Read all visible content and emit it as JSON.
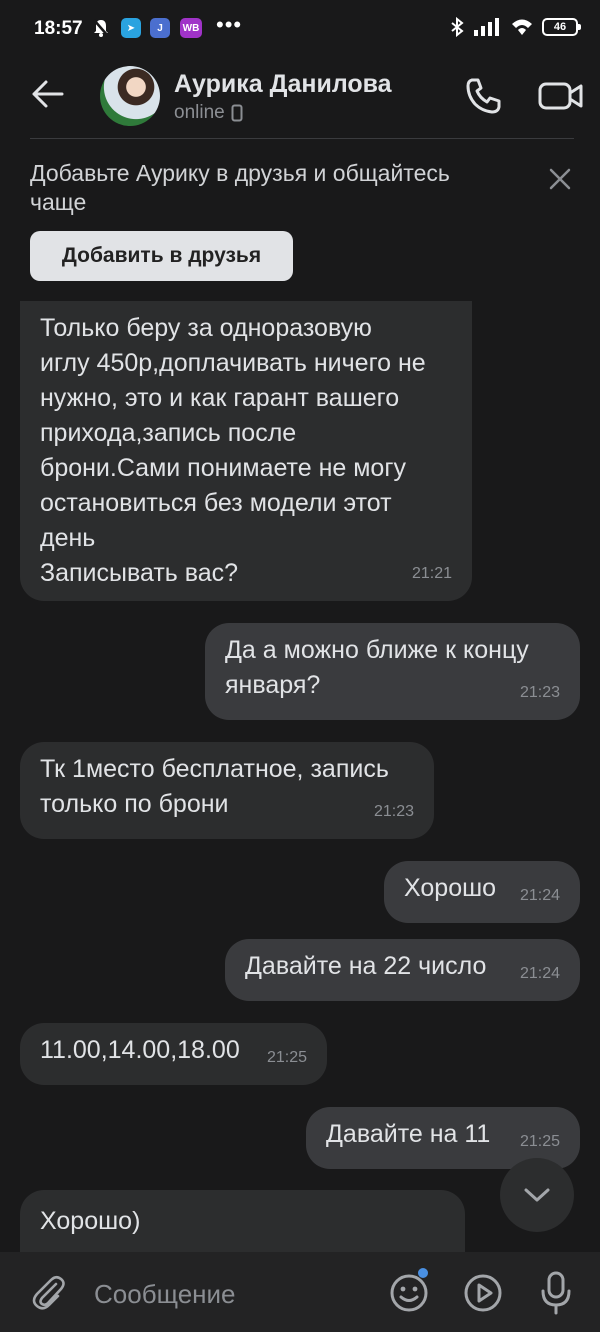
{
  "statusbar": {
    "time": "18:57",
    "app_badge": "WB",
    "dots": "•••",
    "battery": "46"
  },
  "header": {
    "name": "Аурика Данилова",
    "status": "online"
  },
  "banner": {
    "text": "Добавьте Аурику в друзья и общайтесь чаще",
    "button": "Добавить в друзья"
  },
  "messages": [
    {
      "dir": "in",
      "text": "Только беру за одноразовую\nиглу 450р,доплачивать ничего не\nнужно, это и как гарант вашего\nприхода,запись после\nброни.Сами понимаете не могу\nостановиться без модели  этот\nдень\nЗаписывать вас?",
      "time": "21:21"
    },
    {
      "dir": "out",
      "text": "Да а можно ближе к концу\nянваря?",
      "time": "21:23"
    },
    {
      "dir": "in",
      "text": "Тк 1место бесплатное, запись\nтолько по брони",
      "time": "21:23"
    },
    {
      "dir": "out",
      "text": "Хорошо",
      "time": "21:24"
    },
    {
      "dir": "out",
      "text": "Давайте на 22 число",
      "time": "21:24"
    },
    {
      "dir": "in",
      "text": "11.00,14.00,18.00",
      "time": "21:25"
    },
    {
      "dir": "out",
      "text": "Давайте на 11",
      "time": "21:25"
    },
    {
      "dir": "in",
      "text": "Хорошо)",
      "time": ""
    }
  ],
  "composer": {
    "placeholder": "Сообщение"
  },
  "colors": {
    "background": "#19191a",
    "bubble_in": "#2c2d2e",
    "bubble_out": "#3a3b3e",
    "accent": "#4a90e2"
  },
  "icons": [
    "back-arrow-icon",
    "phone-icon",
    "video-camera-icon",
    "close-icon",
    "chevron-down-icon",
    "paperclip-icon",
    "emoji-icon",
    "play-icon",
    "microphone-icon"
  ]
}
